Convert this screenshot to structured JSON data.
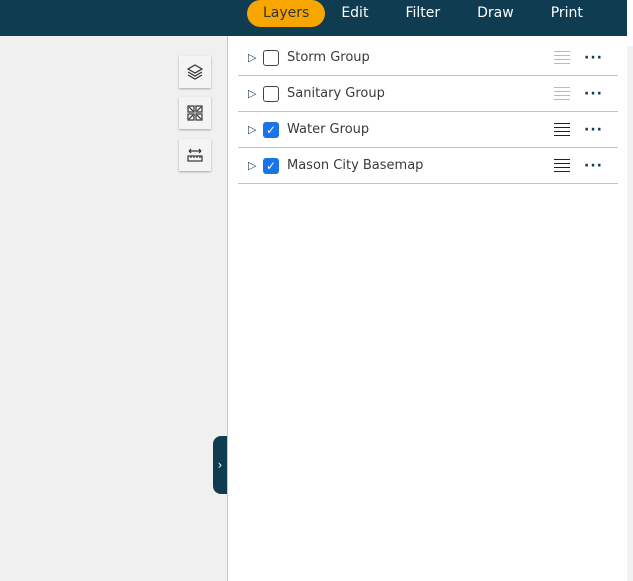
{
  "tabs": [
    {
      "label": "Layers",
      "active": true
    },
    {
      "label": "Edit"
    },
    {
      "label": "Filter"
    },
    {
      "label": "Draw"
    },
    {
      "label": "Print"
    }
  ],
  "layers": [
    {
      "label": "Storm Group",
      "checked": false
    },
    {
      "label": "Sanitary Group",
      "checked": false
    },
    {
      "label": "Water Group",
      "checked": true
    },
    {
      "label": "Mason City Basemap",
      "checked": true
    }
  ],
  "icons": {
    "expand": "▷",
    "check": "✓",
    "more": "···",
    "toggle": "›"
  },
  "colors": {
    "header": "#0f3c50",
    "active_tab": "#f7a600",
    "checkbox": "#1a73e8"
  }
}
